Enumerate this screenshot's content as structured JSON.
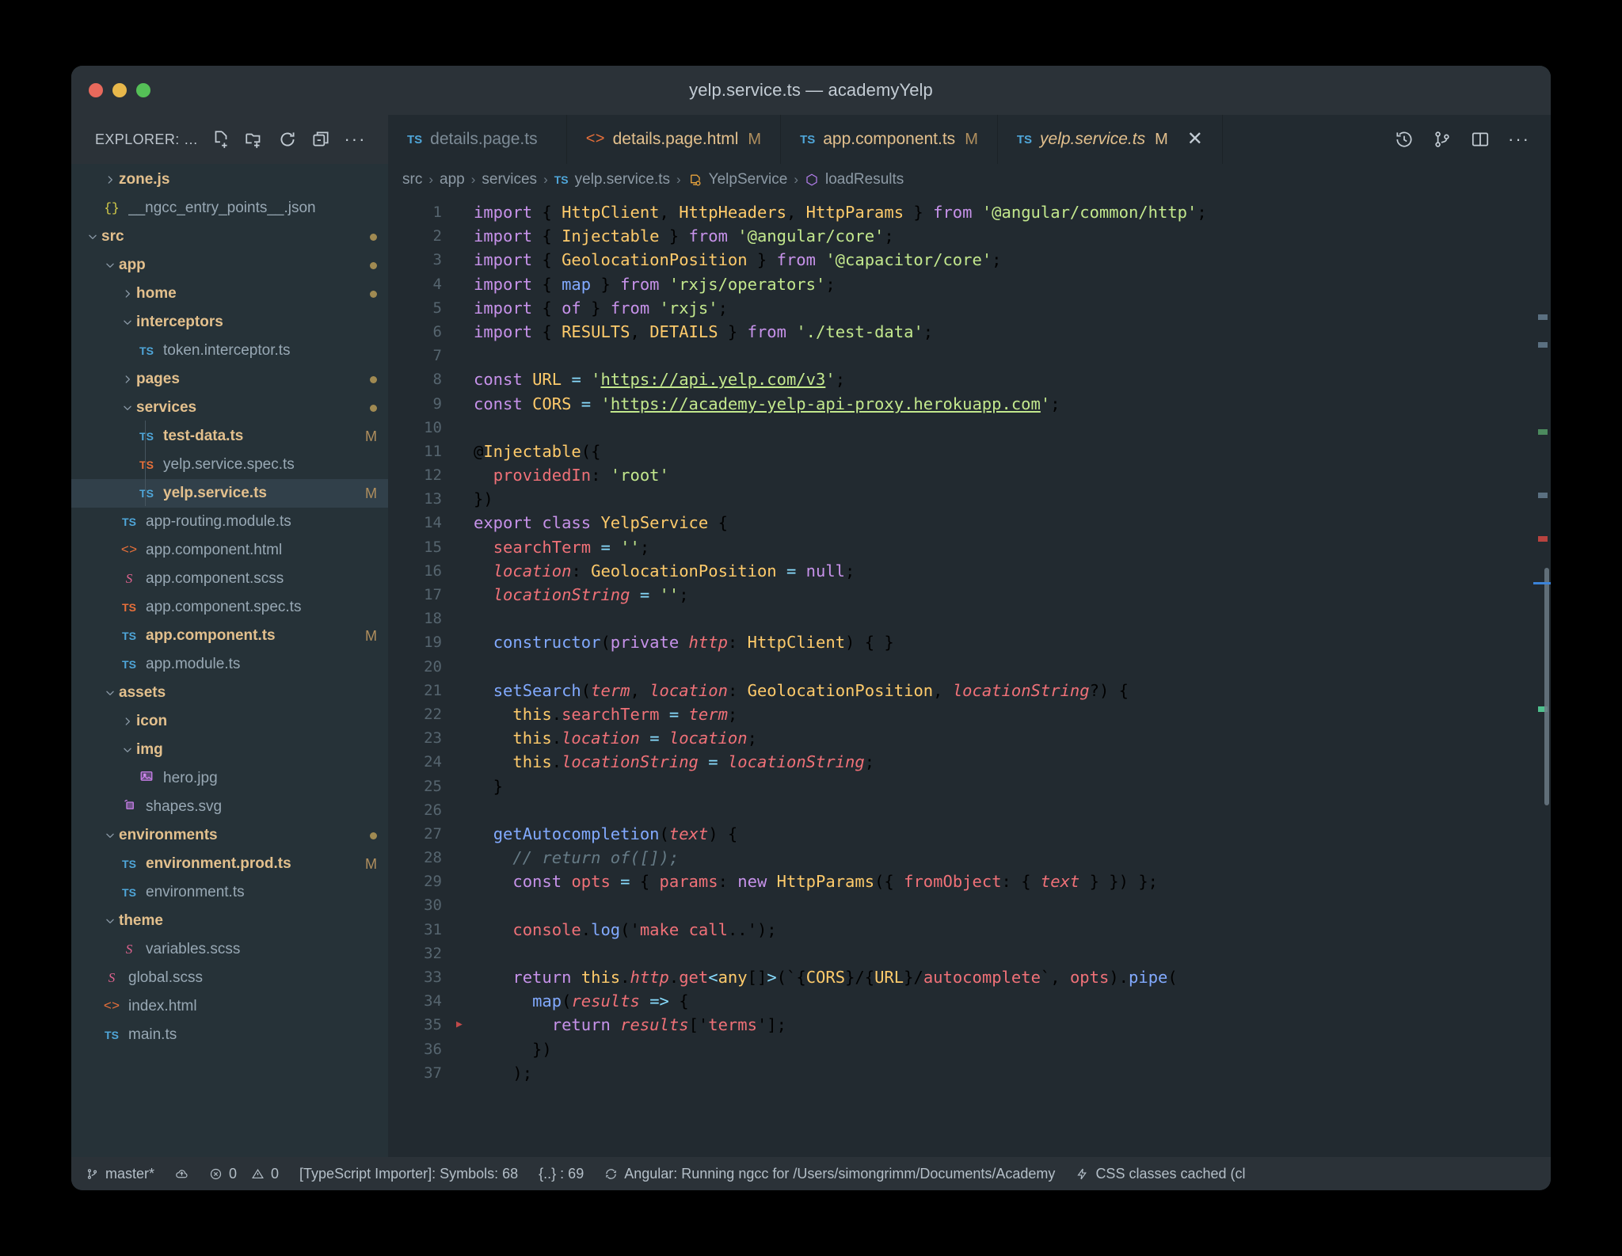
{
  "window": {
    "title": "yelp.service.ts — academyYelp",
    "traffic_lights": [
      "close-red",
      "minimize-yellow",
      "maximize-green"
    ]
  },
  "explorer_header": {
    "label": "EXPLORER: …",
    "actions": [
      "new-file-icon",
      "new-folder-icon",
      "refresh-icon",
      "collapse-all-icon",
      "more-actions-icon"
    ]
  },
  "tabs": [
    {
      "icon": "ts-badge",
      "label": "details.page.ts",
      "modified": "",
      "active": false,
      "dirty": false
    },
    {
      "icon": "html-badge",
      "label": "details.page.html",
      "modified": "M",
      "active": false,
      "dirty": true
    },
    {
      "icon": "ts-badge",
      "label": "app.component.ts",
      "modified": "M",
      "active": false,
      "dirty": true
    },
    {
      "icon": "ts-badge",
      "label": "yelp.service.ts",
      "modified": "M",
      "active": true,
      "dirty": true
    }
  ],
  "tab_actions": [
    "timeline-history-icon",
    "source-control-graph-icon",
    "split-editor-icon",
    "more-editor-actions-icon"
  ],
  "sidebar": {
    "items": [
      {
        "label": "zone.js",
        "type": "folder",
        "depth": 1,
        "state": "collapsed",
        "icon": "chevron-right-icon",
        "badge": "",
        "mod": "",
        "dot": false,
        "partial": false
      },
      {
        "label": "__ngcc_entry_points__.json",
        "type": "file",
        "depth": 1,
        "state": "",
        "icon": "json-badge",
        "badge": "{}",
        "mod": "",
        "dot": false
      },
      {
        "label": "src",
        "type": "folder",
        "depth": 0,
        "state": "expanded",
        "icon": "chevron-down-icon",
        "badge": "",
        "mod": "",
        "dot": true
      },
      {
        "label": "app",
        "type": "folder",
        "depth": 1,
        "state": "expanded",
        "icon": "chevron-down-icon",
        "badge": "",
        "mod": "",
        "dot": true
      },
      {
        "label": "home",
        "type": "folder",
        "depth": 2,
        "state": "collapsed",
        "icon": "chevron-right-icon",
        "badge": "",
        "mod": "",
        "dot": true
      },
      {
        "label": "interceptors",
        "type": "folder",
        "depth": 2,
        "state": "expanded",
        "icon": "chevron-down-icon",
        "badge": "",
        "mod": "",
        "dot": false
      },
      {
        "label": "token.interceptor.ts",
        "type": "file",
        "depth": 3,
        "state": "",
        "icon": "ts-badge",
        "badge": "TS",
        "mod": "",
        "dot": false
      },
      {
        "label": "pages",
        "type": "folder",
        "depth": 2,
        "state": "collapsed",
        "icon": "chevron-right-icon",
        "badge": "",
        "mod": "",
        "dot": true
      },
      {
        "label": "services",
        "type": "folder",
        "depth": 2,
        "state": "expanded",
        "icon": "chevron-down-icon",
        "badge": "",
        "mod": "",
        "dot": true
      },
      {
        "label": "test-data.ts",
        "type": "file",
        "depth": 3,
        "state": "",
        "icon": "ts-badge",
        "badge": "TS",
        "mod": "M",
        "dot": false
      },
      {
        "label": "yelp.service.spec.ts",
        "type": "file",
        "depth": 3,
        "state": "",
        "icon": "ts-badge-orange",
        "badge": "TS",
        "mod": "",
        "dot": false
      },
      {
        "label": "yelp.service.ts",
        "type": "file",
        "depth": 3,
        "state": "selected",
        "icon": "ts-badge",
        "badge": "TS",
        "mod": "M",
        "dot": false
      },
      {
        "label": "app-routing.module.ts",
        "type": "file",
        "depth": 2,
        "state": "",
        "icon": "ts-badge",
        "badge": "TS",
        "mod": "",
        "dot": false
      },
      {
        "label": "app.component.html",
        "type": "file",
        "depth": 2,
        "state": "",
        "icon": "html-badge",
        "badge": "<>",
        "mod": "",
        "dot": false
      },
      {
        "label": "app.component.scss",
        "type": "file",
        "depth": 2,
        "state": "",
        "icon": "scss-badge",
        "badge": "S",
        "mod": "",
        "dot": false
      },
      {
        "label": "app.component.spec.ts",
        "type": "file",
        "depth": 2,
        "state": "",
        "icon": "ts-badge-orange",
        "badge": "TS",
        "mod": "",
        "dot": false
      },
      {
        "label": "app.component.ts",
        "type": "file",
        "depth": 2,
        "state": "",
        "icon": "ts-badge",
        "badge": "TS",
        "mod": "M",
        "dot": false
      },
      {
        "label": "app.module.ts",
        "type": "file",
        "depth": 2,
        "state": "",
        "icon": "ts-badge",
        "badge": "TS",
        "mod": "",
        "dot": false
      },
      {
        "label": "assets",
        "type": "folder",
        "depth": 1,
        "state": "expanded",
        "icon": "chevron-down-icon",
        "badge": "",
        "mod": "",
        "dot": false
      },
      {
        "label": "icon",
        "type": "folder",
        "depth": 2,
        "state": "collapsed",
        "icon": "chevron-right-icon",
        "badge": "",
        "mod": "",
        "dot": false
      },
      {
        "label": "img",
        "type": "folder",
        "depth": 2,
        "state": "expanded",
        "icon": "chevron-down-icon",
        "badge": "",
        "mod": "",
        "dot": false
      },
      {
        "label": "hero.jpg",
        "type": "file",
        "depth": 3,
        "state": "",
        "icon": "image-badge",
        "badge": "",
        "mod": "",
        "dot": false
      },
      {
        "label": "shapes.svg",
        "type": "file",
        "depth": 2,
        "state": "",
        "icon": "svg-badge",
        "badge": "",
        "mod": "",
        "dot": false
      },
      {
        "label": "environments",
        "type": "folder",
        "depth": 1,
        "state": "expanded",
        "icon": "chevron-down-icon",
        "badge": "",
        "mod": "",
        "dot": true
      },
      {
        "label": "environment.prod.ts",
        "type": "file",
        "depth": 2,
        "state": "",
        "icon": "ts-badge",
        "badge": "TS",
        "mod": "M",
        "dot": false
      },
      {
        "label": "environment.ts",
        "type": "file",
        "depth": 2,
        "state": "",
        "icon": "ts-badge",
        "badge": "TS",
        "mod": "",
        "dot": false
      },
      {
        "label": "theme",
        "type": "folder",
        "depth": 1,
        "state": "expanded",
        "icon": "chevron-down-icon",
        "badge": "",
        "mod": "",
        "dot": false
      },
      {
        "label": "variables.scss",
        "type": "file",
        "depth": 2,
        "state": "",
        "icon": "scss-badge",
        "badge": "S",
        "mod": "",
        "dot": false
      },
      {
        "label": "global.scss",
        "type": "file",
        "depth": 1,
        "state": "",
        "icon": "scss-badge",
        "badge": "S",
        "mod": "",
        "dot": false
      },
      {
        "label": "index.html",
        "type": "file",
        "depth": 1,
        "state": "",
        "icon": "html-badge",
        "badge": "<>",
        "mod": "",
        "dot": false
      },
      {
        "label": "main.ts",
        "type": "file",
        "depth": 1,
        "state": "",
        "icon": "ts-badge",
        "badge": "TS",
        "mod": "",
        "dot": false
      }
    ]
  },
  "breadcrumb": {
    "parts": [
      "src",
      "app",
      "services",
      "yelp.service.ts",
      "YelpService",
      "loadResults"
    ],
    "file_icon": "ts-badge",
    "class_icon": "class-symbol-icon",
    "method_icon": "method-symbol-icon"
  },
  "code": {
    "lines": [
      {
        "n": 1,
        "change": "",
        "text": "import { HttpClient, HttpHeaders, HttpParams } from '@angular/common/http';"
      },
      {
        "n": 2,
        "change": "",
        "text": "import { Injectable } from '@angular/core';"
      },
      {
        "n": 3,
        "change": "",
        "text": "import { GeolocationPosition } from '@capacitor/core';"
      },
      {
        "n": 4,
        "change": "",
        "text": "import { map } from 'rxjs/operators';"
      },
      {
        "n": 5,
        "change": "",
        "text": "import { of } from 'rxjs';"
      },
      {
        "n": 6,
        "change": "",
        "text": "import { RESULTS, DETAILS } from './test-data';"
      },
      {
        "n": 7,
        "change": "",
        "text": ""
      },
      {
        "n": 8,
        "change": "",
        "text": "const URL = 'https://api.yelp.com/v3';"
      },
      {
        "n": 9,
        "change": "",
        "text": "const CORS = 'https://academy-yelp-api-proxy.herokuapp.com';"
      },
      {
        "n": 10,
        "change": "",
        "text": ""
      },
      {
        "n": 11,
        "change": "",
        "text": "@Injectable({"
      },
      {
        "n": 12,
        "change": "",
        "text": "  providedIn: 'root'"
      },
      {
        "n": 13,
        "change": "",
        "text": "})"
      },
      {
        "n": 14,
        "change": "",
        "text": "export class YelpService {"
      },
      {
        "n": 15,
        "change": "mod",
        "text": "  searchTerm = '';"
      },
      {
        "n": 16,
        "change": "",
        "text": "  location: GeolocationPosition = null;"
      },
      {
        "n": 17,
        "change": "",
        "text": "  locationString = '';"
      },
      {
        "n": 18,
        "change": "",
        "text": ""
      },
      {
        "n": 19,
        "change": "mod",
        "text": "  constructor(private http: HttpClient) { }"
      },
      {
        "n": 20,
        "change": "",
        "text": ""
      },
      {
        "n": 21,
        "change": "",
        "text": "  setSearch(term, location: GeolocationPosition, locationString?) {"
      },
      {
        "n": 22,
        "change": "",
        "text": "    this.searchTerm = term;"
      },
      {
        "n": 23,
        "change": "",
        "text": "    this.location = location;"
      },
      {
        "n": 24,
        "change": "",
        "text": "    this.locationString = locationString;"
      },
      {
        "n": 25,
        "change": "",
        "text": "  }"
      },
      {
        "n": 26,
        "change": "",
        "text": ""
      },
      {
        "n": 27,
        "change": "",
        "text": "  getAutocompletion(text) {"
      },
      {
        "n": 28,
        "change": "add",
        "text": "    // return of([]);"
      },
      {
        "n": 29,
        "change": "",
        "text": "    const opts = { params: new HttpParams({ fromObject: { text } }) };"
      },
      {
        "n": 30,
        "change": "",
        "text": ""
      },
      {
        "n": 31,
        "change": "",
        "text": "    console.log('make call..');"
      },
      {
        "n": 32,
        "change": "",
        "text": ""
      },
      {
        "n": 33,
        "change": "",
        "text": "    return this.http.get<any[]>(`${CORS}/${URL}/autocomplete`, opts).pipe("
      },
      {
        "n": 34,
        "change": "",
        "text": "      map(results => {"
      },
      {
        "n": 35,
        "change": "fold",
        "text": "        return results['terms'];"
      },
      {
        "n": 36,
        "change": "",
        "text": "      })"
      },
      {
        "n": 37,
        "change": "mod",
        "text": "    );"
      }
    ]
  },
  "status_bar": {
    "branch": "master*",
    "branch_icon": "source-control-icon",
    "sync_icon": "cloud-sync-icon",
    "errors": "0",
    "error_icon": "error-circle-icon",
    "warnings": "0",
    "warning_icon": "warning-triangle-icon",
    "importer": "[TypeScript Importer]: Symbols: 68",
    "brackets": "{..} : 69",
    "ngcc_icon": "sync-spinner-icon",
    "ngcc": "Angular: Running ngcc for /Users/simongrimm/Documents/Academy",
    "css_icon": "zap-icon",
    "css": "CSS classes cached (cl"
  },
  "colors": {
    "editor_bg": "#222a30",
    "sidebar_bg": "#263238",
    "chrome_bg": "#2b3238",
    "selection": "#31404a",
    "accent_string": "#c3e88d",
    "accent_keyword": "#c792ea",
    "accent_identifier": "#f07178",
    "accent_type": "#ffcb6b",
    "accent_function": "#82aaff",
    "accent_operator": "#89ddff",
    "modified_marker": "#b08f5e"
  }
}
